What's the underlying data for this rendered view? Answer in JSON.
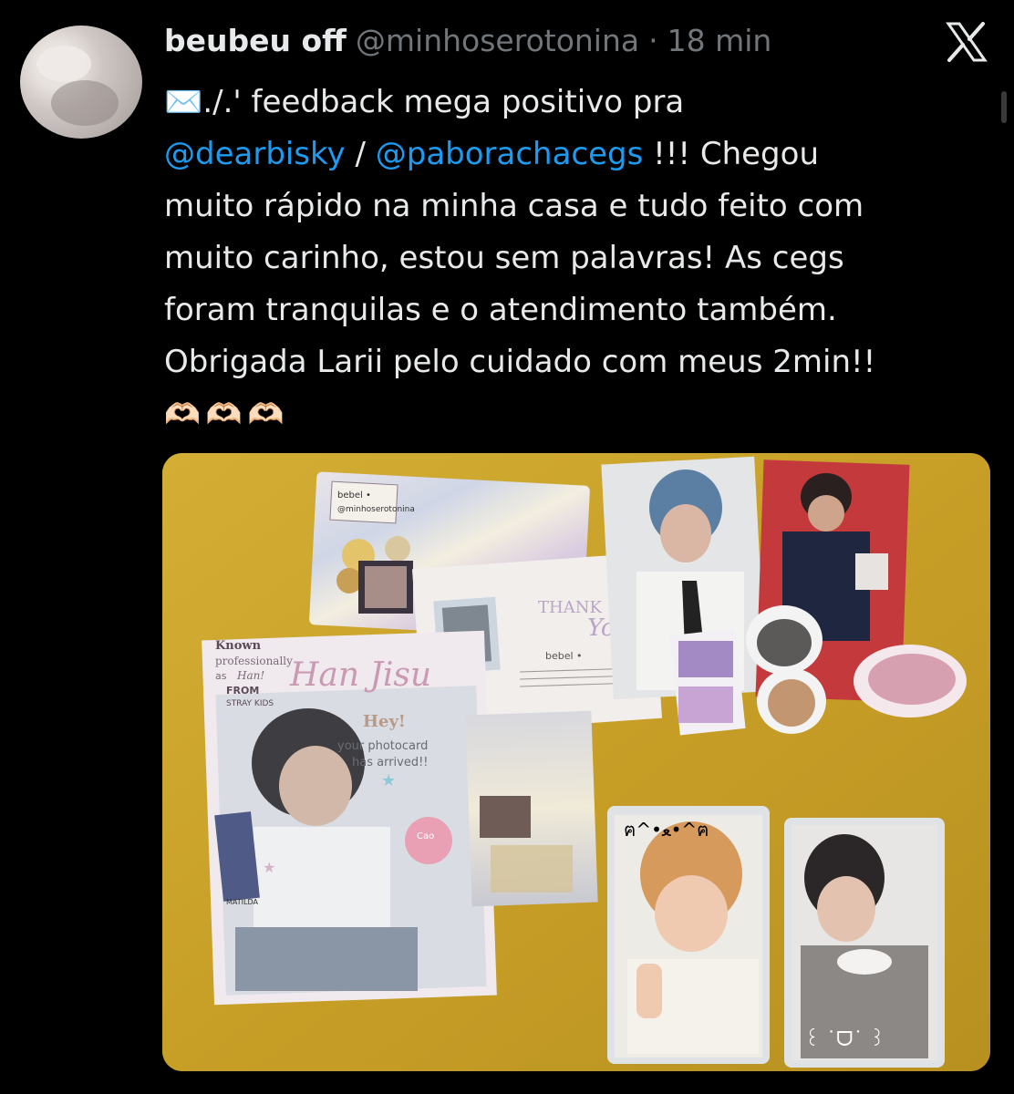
{
  "tweet": {
    "display_name": "beubeu off",
    "handle": "@minhoserotonina",
    "separator": "·",
    "time": "18 min",
    "lines": {
      "l1": "✉️./.' feedback mega positivo pra",
      "mention1": "@dearbisky",
      "slash": " / ",
      "mention2": "@paborachacegs",
      "l2_tail": " !!! Chegou",
      "l3": "muito rápido na minha casa e tudo feito com",
      "l4": "muito carinho, estou sem palavras! As cegs",
      "l5": "foram tranquilas e o atendimento também.",
      "l6": "Obrigada Larii pelo cuidado com meus 2min!!",
      "l7": "🫶🏻🫶🏻🫶🏻"
    }
  },
  "photo": {
    "sticker_name": "bebel •",
    "sticker_handle": "@minhoserotonina",
    "card_known": "Known",
    "card_professionally": "professionally",
    "card_as": "as",
    "card_han_small": "Han!",
    "card_from": "FROM",
    "card_group": "STRAY KIDS",
    "card_name_script": "Han Jisu",
    "card_hey": "Hey!",
    "card_msg1": "your photocard",
    "card_msg2": "has arrived!!",
    "card_small_sticker": "Cao",
    "card_matilda": "MATILDA",
    "thanks_thank": "THANK",
    "thanks_you": "You",
    "thanks_name": "bebel •",
    "pc_caption1": "ฅ^•ﻌ•^ฅ",
    "pc_caption2": "꒰ ˙ᗜ˙ ꒱"
  },
  "colors": {
    "background": "#000000",
    "text": "#e7e9ea",
    "muted": "#71767b",
    "link": "#1d9bf0",
    "table": "#c7a128"
  },
  "icons": {
    "logo": "x-logo-icon"
  }
}
